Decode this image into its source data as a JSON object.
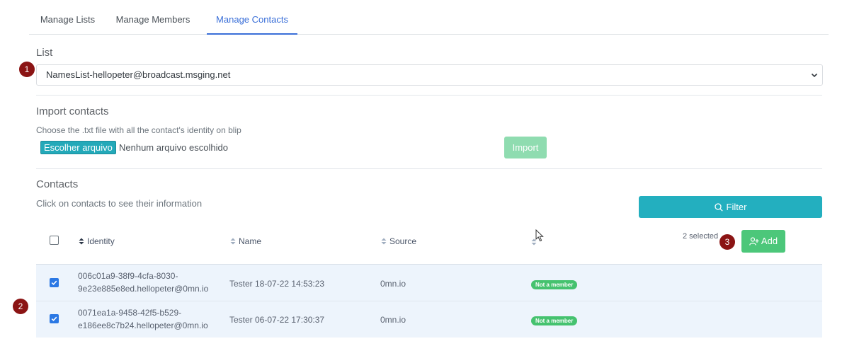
{
  "tabs": [
    {
      "label": "Manage Lists",
      "active": false
    },
    {
      "label": "Manage Members",
      "active": false
    },
    {
      "label": "Manage Contacts",
      "active": true
    }
  ],
  "list_section": {
    "title": "List",
    "selected": "NamesList-hellopeter@broadcast.msging.net"
  },
  "import_section": {
    "title": "Import contacts",
    "description": "Choose the .txt file with all the contact's identity on blip",
    "choose_file_label": "Escolher arquivo",
    "no_file_text": "Nenhum arquivo escolhido",
    "import_label": "Import"
  },
  "contacts_section": {
    "title": "Contacts",
    "description": "Click on contacts to see their information",
    "filter_label": "Filter",
    "selected_text": "2 selected",
    "add_label": "Add"
  },
  "table": {
    "headers": {
      "identity": "Identity",
      "name": "Name",
      "source": "Source"
    },
    "rows": [
      {
        "checked": true,
        "identity_line1": "006c01a9-38f9-4cfa-8030-",
        "identity_line2": "9e23e885e8ed.hellopeter@0mn.io",
        "name": "Tester 18-07-22 14:53:23",
        "source": "0mn.io",
        "status": "Not a member"
      },
      {
        "checked": true,
        "identity_line1": "0071ea1a-9458-42f5-b529-",
        "identity_line2": "e186ee8c7b24.hellopeter@0mn.io",
        "name": "Tester 06-07-22 17:30:37",
        "source": "0mn.io",
        "status": "Not a member"
      }
    ]
  },
  "markers": [
    "1",
    "2",
    "3"
  ],
  "colors": {
    "accent": "#3a6fd8",
    "teal": "#23afbf",
    "green": "#4cc77a",
    "marker": "#8b1414",
    "row_selected": "#edf4fc"
  },
  "icons": {
    "sort": "sort-icon",
    "filter": "search-icon",
    "add": "add-user-icon",
    "select": "chevron-down-icon",
    "cursor": "mouse-pointer-icon"
  }
}
